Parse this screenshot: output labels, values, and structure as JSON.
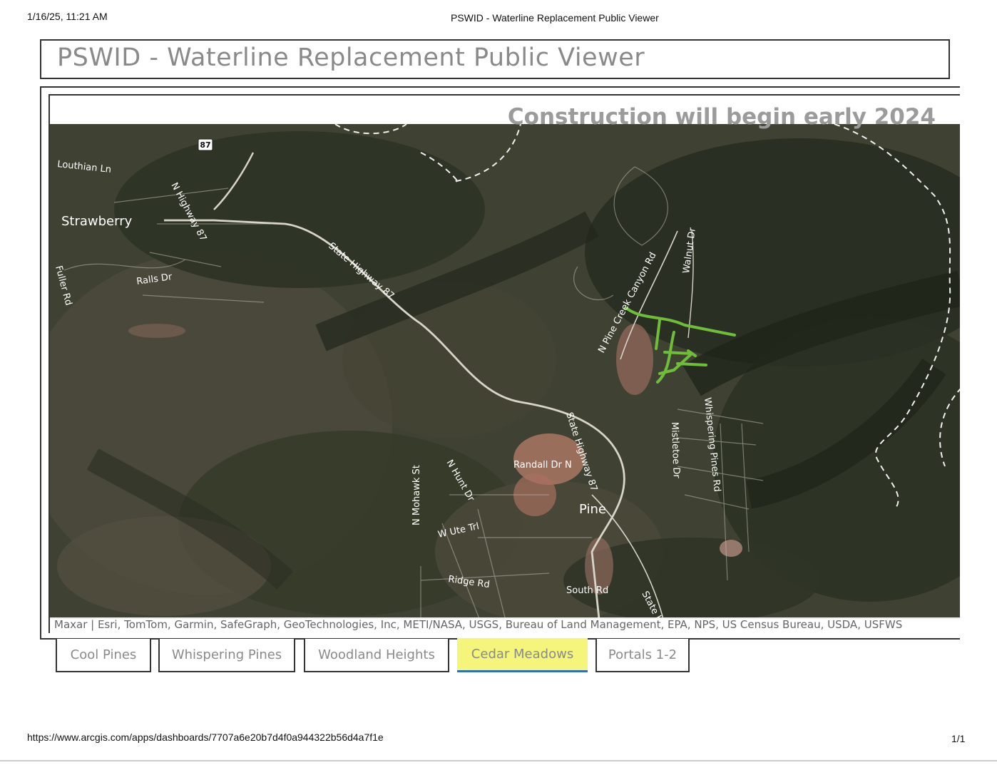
{
  "print_header": {
    "date": "1/16/25, 11:21 AM",
    "title": "PSWID - Waterline Replacement Public Viewer"
  },
  "app": {
    "title": "PSWID - Waterline Replacement Public Viewer"
  },
  "map": {
    "notice": "Construction will begin early 2024",
    "attribution": "Maxar | Esri, TomTom, Garmin, SafeGraph, GeoTechnologies, Inc, METI/NASA, USGS, Bureau of Land Management, EPA, NPS, US Census Bureau, USDA, USFWS",
    "highway_shield": "87",
    "places": {
      "strawberry": "Strawberry",
      "pine": "Pine"
    },
    "roads": {
      "louthian_ln": "Louthian Ln",
      "n_highway_87": "N Highway 87",
      "state_highway_87_a": "State Highway 87",
      "fuller_rd": "Fuller Rd",
      "ralls_dr": "Ralls Dr",
      "n_pine_creek_canyon_rd": "N Pine Creek Canyon Rd",
      "walnut_dr": "Walnut Dr",
      "state_highway_87_b": "State Highway 87",
      "mistletoe_dr": "Mistletoe Dr",
      "whispering_pines_rd": "Whispering Pines Rd",
      "randall_dr_n": "Randall Dr N",
      "n_mohawk_st": "N Mohawk St",
      "n_hunt_dr": "N Hunt Dr",
      "w_ute_trl": "W Ute Trl",
      "ridge_rd": "Ridge Rd",
      "south_rd": "South Rd",
      "state_edge": "State H"
    },
    "colors": {
      "waterline": "#6fbe3a",
      "boundary": "#f2f2f2"
    }
  },
  "tabs": [
    {
      "label": "Cool Pines",
      "active": false
    },
    {
      "label": "Whispering Pines",
      "active": false
    },
    {
      "label": "Woodland Heights",
      "active": false
    },
    {
      "label": "Cedar Meadows",
      "active": true
    },
    {
      "label": "Portals 1-2",
      "active": false
    }
  ],
  "print_footer": {
    "url": "https://www.arcgis.com/apps/dashboards/7707a6e20b7d4f0a944322b56d4a7f1e",
    "page": "1/1"
  }
}
